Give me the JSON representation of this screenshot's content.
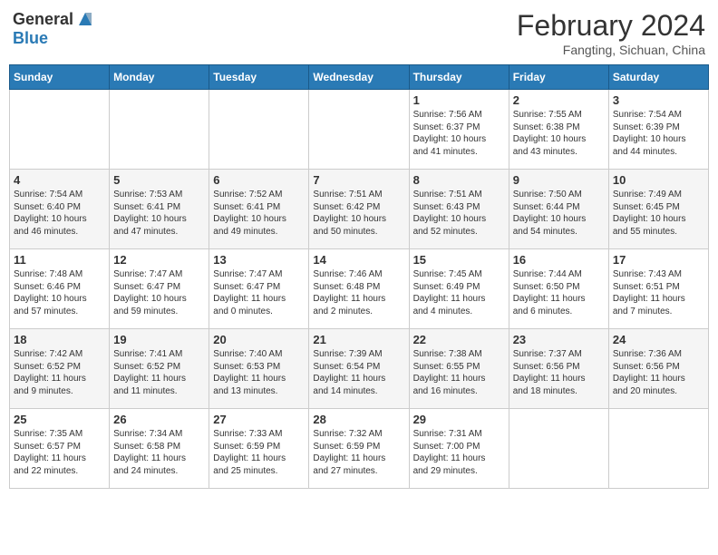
{
  "header": {
    "logo_general": "General",
    "logo_blue": "Blue",
    "month_year": "February 2024",
    "location": "Fangting, Sichuan, China"
  },
  "days_of_week": [
    "Sunday",
    "Monday",
    "Tuesday",
    "Wednesday",
    "Thursday",
    "Friday",
    "Saturday"
  ],
  "weeks": [
    [
      {
        "day": "",
        "info": ""
      },
      {
        "day": "",
        "info": ""
      },
      {
        "day": "",
        "info": ""
      },
      {
        "day": "",
        "info": ""
      },
      {
        "day": "1",
        "info": "Sunrise: 7:56 AM\nSunset: 6:37 PM\nDaylight: 10 hours\nand 41 minutes."
      },
      {
        "day": "2",
        "info": "Sunrise: 7:55 AM\nSunset: 6:38 PM\nDaylight: 10 hours\nand 43 minutes."
      },
      {
        "day": "3",
        "info": "Sunrise: 7:54 AM\nSunset: 6:39 PM\nDaylight: 10 hours\nand 44 minutes."
      }
    ],
    [
      {
        "day": "4",
        "info": "Sunrise: 7:54 AM\nSunset: 6:40 PM\nDaylight: 10 hours\nand 46 minutes."
      },
      {
        "day": "5",
        "info": "Sunrise: 7:53 AM\nSunset: 6:41 PM\nDaylight: 10 hours\nand 47 minutes."
      },
      {
        "day": "6",
        "info": "Sunrise: 7:52 AM\nSunset: 6:41 PM\nDaylight: 10 hours\nand 49 minutes."
      },
      {
        "day": "7",
        "info": "Sunrise: 7:51 AM\nSunset: 6:42 PM\nDaylight: 10 hours\nand 50 minutes."
      },
      {
        "day": "8",
        "info": "Sunrise: 7:51 AM\nSunset: 6:43 PM\nDaylight: 10 hours\nand 52 minutes."
      },
      {
        "day": "9",
        "info": "Sunrise: 7:50 AM\nSunset: 6:44 PM\nDaylight: 10 hours\nand 54 minutes."
      },
      {
        "day": "10",
        "info": "Sunrise: 7:49 AM\nSunset: 6:45 PM\nDaylight: 10 hours\nand 55 minutes."
      }
    ],
    [
      {
        "day": "11",
        "info": "Sunrise: 7:48 AM\nSunset: 6:46 PM\nDaylight: 10 hours\nand 57 minutes."
      },
      {
        "day": "12",
        "info": "Sunrise: 7:47 AM\nSunset: 6:47 PM\nDaylight: 10 hours\nand 59 minutes."
      },
      {
        "day": "13",
        "info": "Sunrise: 7:47 AM\nSunset: 6:47 PM\nDaylight: 11 hours\nand 0 minutes."
      },
      {
        "day": "14",
        "info": "Sunrise: 7:46 AM\nSunset: 6:48 PM\nDaylight: 11 hours\nand 2 minutes."
      },
      {
        "day": "15",
        "info": "Sunrise: 7:45 AM\nSunset: 6:49 PM\nDaylight: 11 hours\nand 4 minutes."
      },
      {
        "day": "16",
        "info": "Sunrise: 7:44 AM\nSunset: 6:50 PM\nDaylight: 11 hours\nand 6 minutes."
      },
      {
        "day": "17",
        "info": "Sunrise: 7:43 AM\nSunset: 6:51 PM\nDaylight: 11 hours\nand 7 minutes."
      }
    ],
    [
      {
        "day": "18",
        "info": "Sunrise: 7:42 AM\nSunset: 6:52 PM\nDaylight: 11 hours\nand 9 minutes."
      },
      {
        "day": "19",
        "info": "Sunrise: 7:41 AM\nSunset: 6:52 PM\nDaylight: 11 hours\nand 11 minutes."
      },
      {
        "day": "20",
        "info": "Sunrise: 7:40 AM\nSunset: 6:53 PM\nDaylight: 11 hours\nand 13 minutes."
      },
      {
        "day": "21",
        "info": "Sunrise: 7:39 AM\nSunset: 6:54 PM\nDaylight: 11 hours\nand 14 minutes."
      },
      {
        "day": "22",
        "info": "Sunrise: 7:38 AM\nSunset: 6:55 PM\nDaylight: 11 hours\nand 16 minutes."
      },
      {
        "day": "23",
        "info": "Sunrise: 7:37 AM\nSunset: 6:56 PM\nDaylight: 11 hours\nand 18 minutes."
      },
      {
        "day": "24",
        "info": "Sunrise: 7:36 AM\nSunset: 6:56 PM\nDaylight: 11 hours\nand 20 minutes."
      }
    ],
    [
      {
        "day": "25",
        "info": "Sunrise: 7:35 AM\nSunset: 6:57 PM\nDaylight: 11 hours\nand 22 minutes."
      },
      {
        "day": "26",
        "info": "Sunrise: 7:34 AM\nSunset: 6:58 PM\nDaylight: 11 hours\nand 24 minutes."
      },
      {
        "day": "27",
        "info": "Sunrise: 7:33 AM\nSunset: 6:59 PM\nDaylight: 11 hours\nand 25 minutes."
      },
      {
        "day": "28",
        "info": "Sunrise: 7:32 AM\nSunset: 6:59 PM\nDaylight: 11 hours\nand 27 minutes."
      },
      {
        "day": "29",
        "info": "Sunrise: 7:31 AM\nSunset: 7:00 PM\nDaylight: 11 hours\nand 29 minutes."
      },
      {
        "day": "",
        "info": ""
      },
      {
        "day": "",
        "info": ""
      }
    ]
  ]
}
